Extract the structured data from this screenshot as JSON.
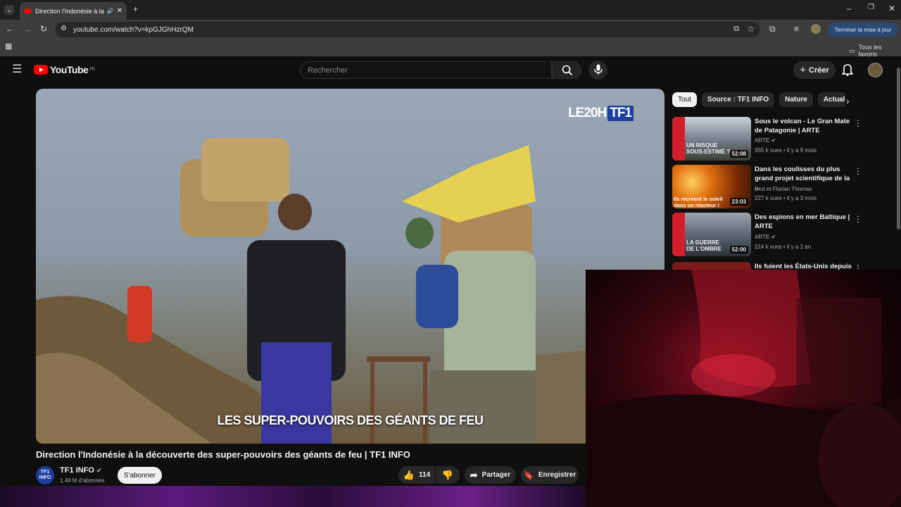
{
  "browser": {
    "tab_title": "Direction l'Indonésie à la dé",
    "url": "youtube.com/watch?v=kpGJGhHzrQM",
    "update_label": "Terminer la mise à jour",
    "bookmarks_label": "Tous les favoris"
  },
  "header": {
    "logo_text": "YouTube",
    "region": "FR",
    "search_placeholder": "Rechercher",
    "create_label": "Créer"
  },
  "video": {
    "overlay_brand": "LE20H",
    "overlay_channel": "TF1",
    "caption": "LES SUPER-POUVOIRS DES GÉANTS DE FEU",
    "title": "Direction l'Indonésie à la découverte des super-pouvoirs des géants de feu | TF1 INFO",
    "channel_logo": "TF1 INFO",
    "channel_name": "TF1 INFO",
    "subscribers": "1,48 M d'abonnés",
    "subscribe_label": "S'abonner",
    "likes": "114",
    "share_label": "Partager",
    "save_label": "Enregistrer"
  },
  "chips": [
    "Tout",
    "Source : TF1 INFO",
    "Nature",
    "Actualité"
  ],
  "recommendations": [
    {
      "title": "Sous le volcan - Le Gran Mate de Patagonie | ARTE",
      "channel": "ARTE",
      "meta": "355 k vues • il y a 9 mois",
      "duration": "52:08",
      "thumb_text": "UN RISQUE SOUS-ESTIMÉ ?",
      "thumb_color": "#6b7480"
    },
    {
      "title": "Dans les coulisses du plus grand projet scientifique de la ...",
      "channel": "Brut et Florian Thomas",
      "meta": "227 k vues • il y a 3 mois",
      "duration": "23:03",
      "thumb_text": "Ils recréent le soleil dans un réacteur !",
      "thumb_color": "#b85a10"
    },
    {
      "title": "Des espions en mer Baltique | ARTE",
      "channel": "ARTE",
      "meta": "214 k vues • il y a 1 an",
      "duration": "52:00",
      "thumb_text": "LA GUERRE DE L'OMBRE",
      "thumb_color": "#4c5560"
    },
    {
      "title": "Ils fuient les États-Unis depuis",
      "channel": "",
      "meta": "",
      "duration": "",
      "thumb_text": "",
      "thumb_color": "#7a1a1a"
    }
  ]
}
